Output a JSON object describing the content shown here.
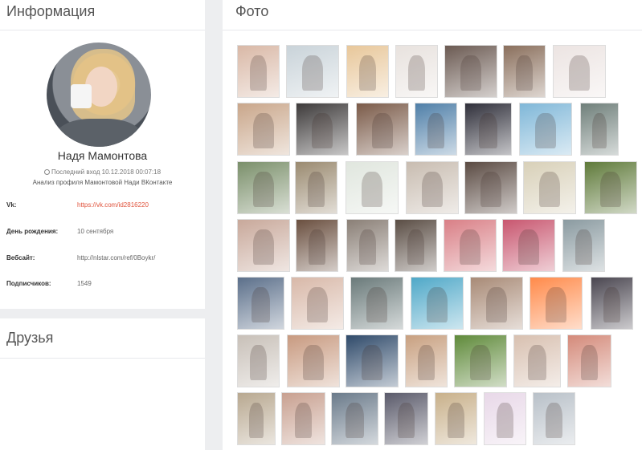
{
  "info_panel": {
    "title": "Информация",
    "name": "Надя Мамонтова",
    "last_seen": "Последний вход 10.12.2018 00:07:18",
    "analysis": "Анализ профиля Мамонтовой Нади ВКонтакте",
    "rows": [
      {
        "label": "Vk:",
        "value": "https://vk.com/id2816220"
      },
      {
        "label": "День рождения:",
        "value": "10 сентября"
      },
      {
        "label": "Вебсайт:",
        "value": "http://nlstar.com/ref/0Boykr/"
      },
      {
        "label": "Подписчиков:",
        "value": "1549"
      }
    ]
  },
  "friends_panel": {
    "title": "Друзья"
  },
  "photos_panel": {
    "title": "Фото"
  },
  "photo_colors": [
    [
      "#d9b8a6",
      "#c9d3d9",
      "#e8c79a",
      "#e8e2de",
      "#6b5a52",
      "#8a6f5c",
      "#ece4e2"
    ],
    [
      "#c9a68a",
      "#3d3a3a",
      "#7a5a48",
      "#4f7fa8",
      "#2f2f3a",
      "#7fb7d8",
      "#6f7f7a"
    ],
    [
      "#7a8f6a",
      "#9a8a70",
      "#e0e6de",
      "#c8bcb0",
      "#5a4a42",
      "#d8d0b8",
      "#5f7a3a"
    ],
    [
      "#c8a89a",
      "#6a4f3f",
      "#8a7f76",
      "#5a4d44",
      "#d97f86",
      "#c8566f",
      "#8a9aa0"
    ],
    [
      "#5b6f8a",
      "#d8b8a8",
      "#6a7a7a",
      "#4fa8c8",
      "#a88a76",
      "#ff8a4a",
      "#4a4650"
    ],
    [
      "#c8c0b8",
      "#c89a80",
      "#2f4a6a",
      "#c8a080",
      "#5f8a3a",
      "#d8c0b0",
      "#d48a7a"
    ],
    [
      "#b8a890",
      "#c8a090",
      "#6a7a8a",
      "#5a5a6a",
      "#c8b08a",
      "#e8d8e8",
      "#b8c0c8"
    ]
  ]
}
